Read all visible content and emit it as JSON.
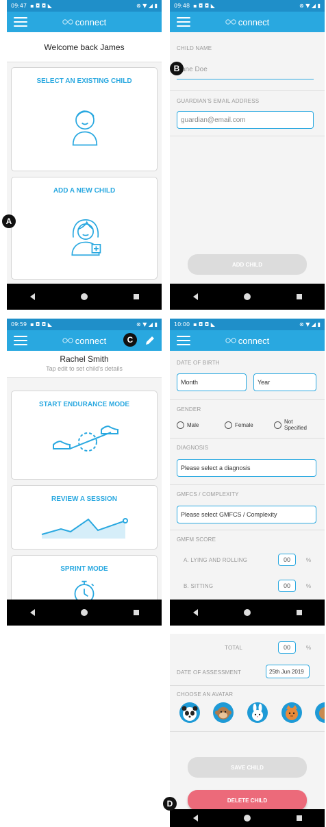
{
  "phone1": {
    "time": "09:47",
    "brand": "connect",
    "welcome": "Welcome back James",
    "card1": "SELECT AN EXISTING CHILD",
    "card2": "ADD A NEW CHILD"
  },
  "phone2": {
    "time": "09:48",
    "brand": "connect",
    "child_label": "CHILD NAME",
    "child_placeholder": "Jane Doe",
    "email_label": "GUARDIAN'S EMAIL ADDRESS",
    "email_placeholder": "guardian@email.com",
    "add_btn": "ADD CHILD"
  },
  "phone3": {
    "time": "09:59",
    "brand": "connect",
    "name": "Rachel Smith",
    "hint": "Tap edit to set child's details",
    "card1": "START ENDURANCE MODE",
    "card2": "REVIEW A SESSION",
    "card3": "SPRINT MODE"
  },
  "phone4": {
    "time": "10:00",
    "brand": "connect",
    "dob_label": "DATE OF BIRTH",
    "month": "Month",
    "year": "Year",
    "gender_label": "GENDER",
    "male": "Male",
    "female": "Female",
    "not_spec": "Not Specified",
    "diag_label": "DIAGNOSIS",
    "diag_value": "Please select a diagnosis",
    "gmfcs_label": "GMFCS / COMPLEXITY",
    "gmfcs_value": "Please select GMFCS / Complexity",
    "gmfm_label": "GMFM SCORE",
    "a_label": "A. LYING AND ROLLING",
    "a_value": "00",
    "b_label": "B. SITTING",
    "b_value": "00",
    "pct": "%"
  },
  "phone5": {
    "total_label": "TOTAL",
    "total_value": "00",
    "pct": "%",
    "doa_label": "DATE OF ASSESSMENT",
    "doa_value": "25th Jun 2019",
    "avatar_label": "CHOOSE AN AVATAR",
    "save_btn": "SAVE CHILD",
    "delete_btn": "DELETE CHILD"
  },
  "markers": {
    "a": "A",
    "b": "B",
    "c": "C",
    "d": "D"
  },
  "colors": {
    "primary": "#29a8e0",
    "status": "#1f8fc9",
    "delete": "#ec6a7a",
    "disabled": "#d8d8d8"
  }
}
